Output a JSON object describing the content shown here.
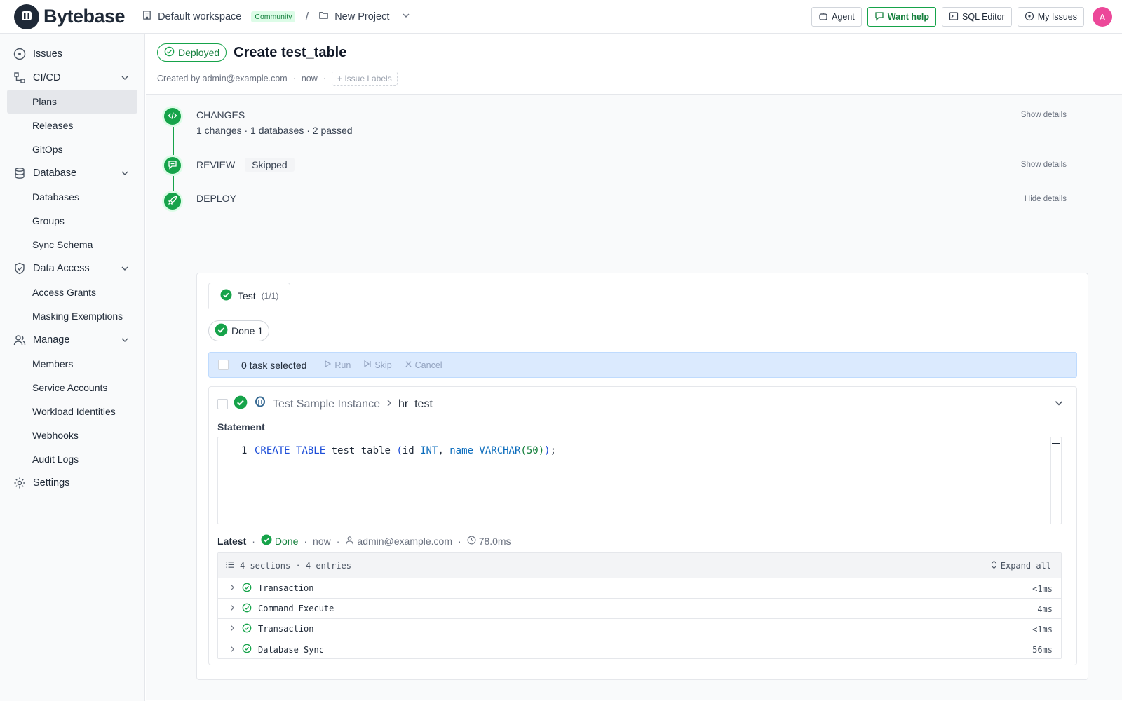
{
  "brand": {
    "name": "Bytebase"
  },
  "workspace": {
    "name": "Default workspace",
    "tier": "Community"
  },
  "project": {
    "name": "New Project"
  },
  "topbar": {
    "agent": "Agent",
    "want_help": "Want help",
    "sql_editor": "SQL Editor",
    "my_issues": "My Issues",
    "avatar_initial": "A"
  },
  "sidebar": {
    "issues": "Issues",
    "cicd": "CI/CD",
    "cicd_items": [
      "Plans",
      "Releases",
      "GitOps"
    ],
    "database": "Database",
    "database_items": [
      "Databases",
      "Groups",
      "Sync Schema"
    ],
    "data_access": "Data Access",
    "data_access_items": [
      "Access Grants",
      "Masking Exemptions"
    ],
    "manage": "Manage",
    "manage_items": [
      "Members",
      "Service Accounts",
      "Workload Identities",
      "Webhooks",
      "Audit Logs"
    ],
    "settings": "Settings"
  },
  "issue": {
    "status": "Deployed",
    "title": "Create test_table",
    "created_by": "Created by admin@example.com",
    "time": "now",
    "labels_placeholder": "Issue Labels"
  },
  "steps": {
    "changes": {
      "title": "CHANGES",
      "summary": "1 changes · 1 databases · 2 passed",
      "toggle": "Show details"
    },
    "review": {
      "title": "REVIEW",
      "status": "Skipped",
      "toggle": "Show details"
    },
    "deploy": {
      "title": "DEPLOY",
      "toggle": "Hide details"
    }
  },
  "deploy": {
    "env_tab": {
      "name": "Test",
      "count": "(1/1)"
    },
    "done_filter": "Done 1",
    "task_bar": {
      "selected": "0 task selected",
      "run": "Run",
      "skip": "Skip",
      "cancel": "Cancel"
    },
    "task": {
      "instance": "Test Sample Instance",
      "database": "hr_test",
      "statement_label": "Statement",
      "line_number": "1",
      "latest": "Latest",
      "status": "Done",
      "time": "now",
      "user": "admin@example.com",
      "duration": "78.0ms",
      "log_summary": "4 sections · 4 entries",
      "expand_all": "Expand all",
      "logs": [
        {
          "name": "Transaction",
          "duration": "<1ms"
        },
        {
          "name": "Command Execute",
          "duration": "4ms"
        },
        {
          "name": "Transaction",
          "duration": "<1ms"
        },
        {
          "name": "Database Sync",
          "duration": "56ms"
        }
      ]
    }
  },
  "code": {
    "kw1": "CREATE",
    "kw2": "TABLE",
    "tbl": "test_table",
    "lp": "(",
    "col1": "id",
    "ty1": "INT",
    "comma": ",",
    "col2": "name",
    "ty2": "VARCHAR",
    "lp2": "(",
    "n": "50",
    "rp2": ")",
    "rp": ")",
    "semi": ";"
  },
  "colors": {
    "accent": "#16a34a",
    "avatar": "#ec4899",
    "taskbar": "#dbeafe"
  },
  "icons": [
    "issues-icon",
    "cicd-icon",
    "database-icon",
    "shield-icon",
    "users-icon",
    "gear-icon",
    "agent-icon",
    "chat-icon",
    "terminal-icon",
    "circle-dot-icon",
    "building-icon",
    "folder-icon",
    "code-icon",
    "message-icon",
    "rocket-icon",
    "check-circle-icon",
    "postgres-icon",
    "list-icon",
    "clock-icon",
    "user-icon"
  ]
}
